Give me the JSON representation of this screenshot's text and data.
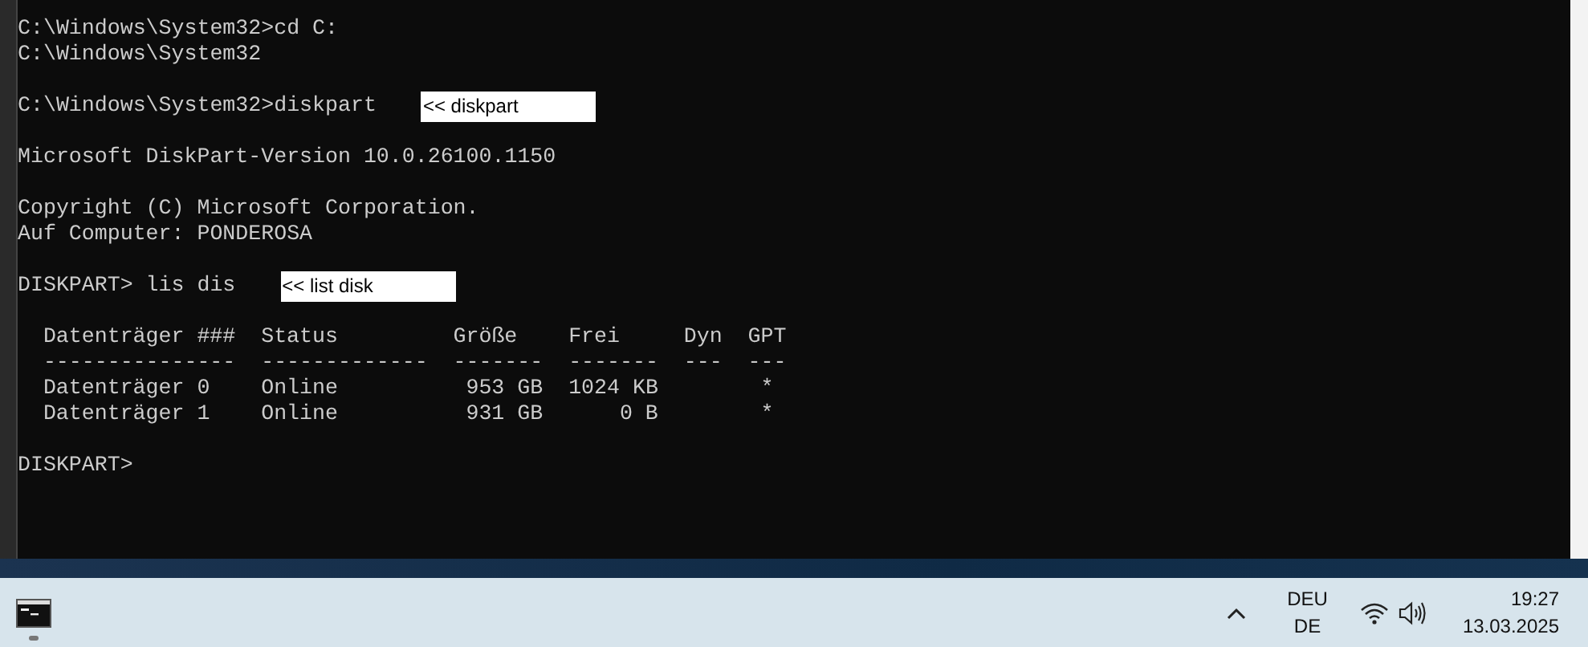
{
  "console": {
    "blocks": [
      [
        {
          "text": "C:\\Windows\\System32>cd C:"
        },
        {
          "text": "C:\\Windows\\System32"
        }
      ],
      [
        {
          "text": "C:\\Windows\\System32>diskpart",
          "note": "<< diskpart"
        }
      ],
      [
        {
          "text": "Microsoft DiskPart-Version 10.0.26100.1150"
        }
      ],
      [
        {
          "text": "Copyright (C) Microsoft Corporation."
        },
        {
          "text": "Auf Computer: PONDEROSA"
        }
      ],
      [
        {
          "text": "DISKPART> lis dis",
          "note": "<< list disk"
        }
      ]
    ],
    "table": {
      "columns": [
        "Datenträger ###",
        "Status",
        "Größe",
        "Frei",
        "Dyn",
        "GPT"
      ],
      "separator": [
        "---------------",
        "-------------",
        "-------",
        "-------",
        "---",
        "---"
      ],
      "rows": [
        [
          "Datenträger 0",
          "Online",
          "953 GB",
          "1024 KB",
          null,
          "*"
        ],
        [
          "Datenträger 1",
          "Online",
          "931 GB",
          "0 B",
          null,
          "*"
        ]
      ]
    },
    "prompt": "DISKPART>"
  },
  "taskbar": {
    "tray": {
      "language": "DEU",
      "layout": "DE",
      "time": "19:27",
      "date": "13.03.2025"
    }
  }
}
